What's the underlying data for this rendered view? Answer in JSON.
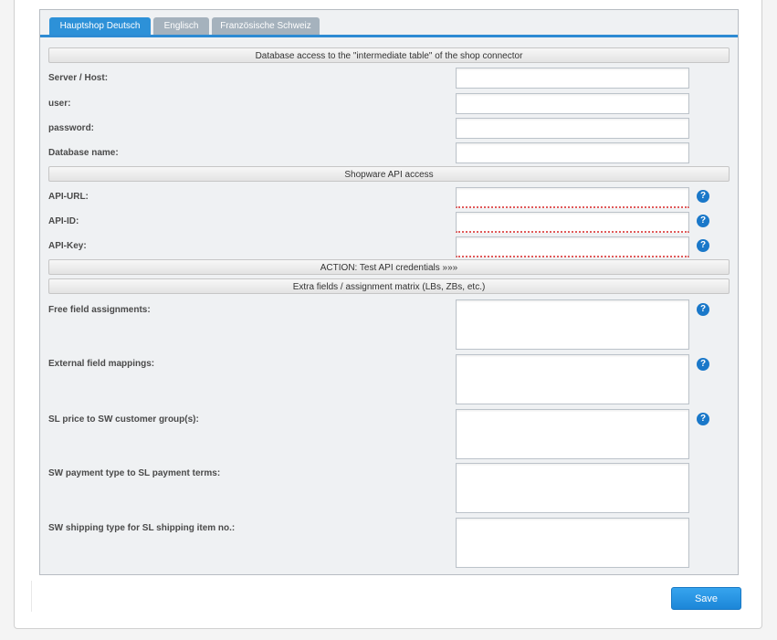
{
  "tabs": [
    {
      "label": "Hauptshop Deutsch",
      "active": true
    },
    {
      "label": "Englisch",
      "active": false
    },
    {
      "label": "Französische Schweiz",
      "active": false
    }
  ],
  "sections": {
    "db": "Database access to the \"intermediate table\" of the shop connector",
    "api": "Shopware API access",
    "test_action": "ACTION: Test API credentials »»»",
    "extra": "Extra fields / assignment matrix (LBs, ZBs, etc.)"
  },
  "db_fields": {
    "server": {
      "label": "Server / Host:",
      "value": ""
    },
    "user": {
      "label": "user:",
      "value": ""
    },
    "password": {
      "label": "password:",
      "value": ""
    },
    "dbname": {
      "label": "Database name:",
      "value": ""
    }
  },
  "api_fields": {
    "url": {
      "label": "API-URL:",
      "value": ""
    },
    "id": {
      "label": "API-ID:",
      "value": ""
    },
    "key": {
      "label": "API-Key:",
      "value": ""
    }
  },
  "extra_fields": {
    "free": {
      "label": "Free field assignments:",
      "value": ""
    },
    "external": {
      "label": "External field mappings:",
      "value": ""
    },
    "price": {
      "label": "SL price to SW customer group(s):",
      "value": ""
    },
    "payment": {
      "label": "SW payment type to SL payment terms:",
      "value": ""
    },
    "shipping": {
      "label": "SW shipping type for SL shipping item no.:",
      "value": ""
    }
  },
  "help_glyph": "?",
  "save_label": "Save",
  "colors": {
    "accent": "#2d91d8",
    "tab_inactive": "#a5b2bd",
    "help_icon": "#1a78c9",
    "panel_bg": "#eff1f3"
  }
}
